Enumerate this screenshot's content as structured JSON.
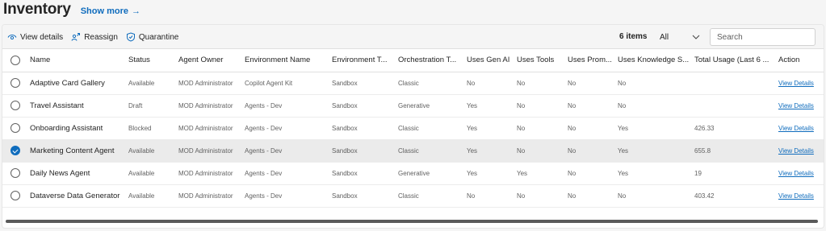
{
  "header": {
    "title": "Inventory",
    "show_more": "Show more",
    "show_more_arrow": "→"
  },
  "toolbar": {
    "view_details": "View details",
    "reassign": "Reassign",
    "quarantine": "Quarantine",
    "items_count": "6 items",
    "filter_value": "All",
    "search_placeholder": "Search"
  },
  "table": {
    "columns": [
      "Name",
      "Status",
      "Agent Owner",
      "Environment Name",
      "Environment T...",
      "Orchestration T...",
      "Uses Gen AI",
      "Uses Tools",
      "Uses Prom...",
      "Uses Knowledge S...",
      "Total Usage (Last 6 ...",
      "Action"
    ],
    "rows": [
      {
        "selected": false,
        "name": "Adaptive Card Gallery",
        "status": "Available",
        "owner": "MOD Administrator",
        "env_name": "Copilot Agent Kit",
        "env_type": "Sandbox",
        "orchestration": "Classic",
        "gen_ai": "No",
        "tools": "No",
        "prompts": "No",
        "knowledge": "No",
        "usage": "",
        "action": "View Details"
      },
      {
        "selected": false,
        "name": "Travel Assistant",
        "status": "Draft",
        "owner": "MOD Administrator",
        "env_name": "Agents - Dev",
        "env_type": "Sandbox",
        "orchestration": "Generative",
        "gen_ai": "Yes",
        "tools": "No",
        "prompts": "No",
        "knowledge": "No",
        "usage": "",
        "action": "View Details"
      },
      {
        "selected": false,
        "name": "Onboarding Assistant",
        "status": "Blocked",
        "owner": "MOD Administrator",
        "env_name": "Agents - Dev",
        "env_type": "Sandbox",
        "orchestration": "Classic",
        "gen_ai": "Yes",
        "tools": "No",
        "prompts": "No",
        "knowledge": "Yes",
        "usage": "426.33",
        "action": "View Details"
      },
      {
        "selected": true,
        "name": "Marketing Content Agent",
        "status": "Available",
        "owner": "MOD Administrator",
        "env_name": "Agents - Dev",
        "env_type": "Sandbox",
        "orchestration": "Classic",
        "gen_ai": "Yes",
        "tools": "No",
        "prompts": "No",
        "knowledge": "Yes",
        "usage": "655.8",
        "action": "View Details"
      },
      {
        "selected": false,
        "name": "Daily News Agent",
        "status": "Available",
        "owner": "MOD Administrator",
        "env_name": "Agents - Dev",
        "env_type": "Sandbox",
        "orchestration": "Generative",
        "gen_ai": "Yes",
        "tools": "Yes",
        "prompts": "No",
        "knowledge": "Yes",
        "usage": "19",
        "action": "View Details"
      },
      {
        "selected": false,
        "name": "Dataverse Data Generator",
        "status": "Available",
        "owner": "MOD Administrator",
        "env_name": "Agents - Dev",
        "env_type": "Sandbox",
        "orchestration": "Classic",
        "gen_ai": "No",
        "tools": "No",
        "prompts": "No",
        "knowledge": "No",
        "usage": "403.42",
        "action": "View Details"
      }
    ]
  },
  "colors": {
    "accent": "#0f6cbd",
    "selected_row": "#ebebeb",
    "toolbar_bg": "#f5f5f5"
  },
  "icons": {
    "view_details": "eye-icon",
    "reassign": "people-swap-icon",
    "quarantine": "shield-icon",
    "filter": "chevron-down-icon",
    "row_select": "radio-icon"
  }
}
